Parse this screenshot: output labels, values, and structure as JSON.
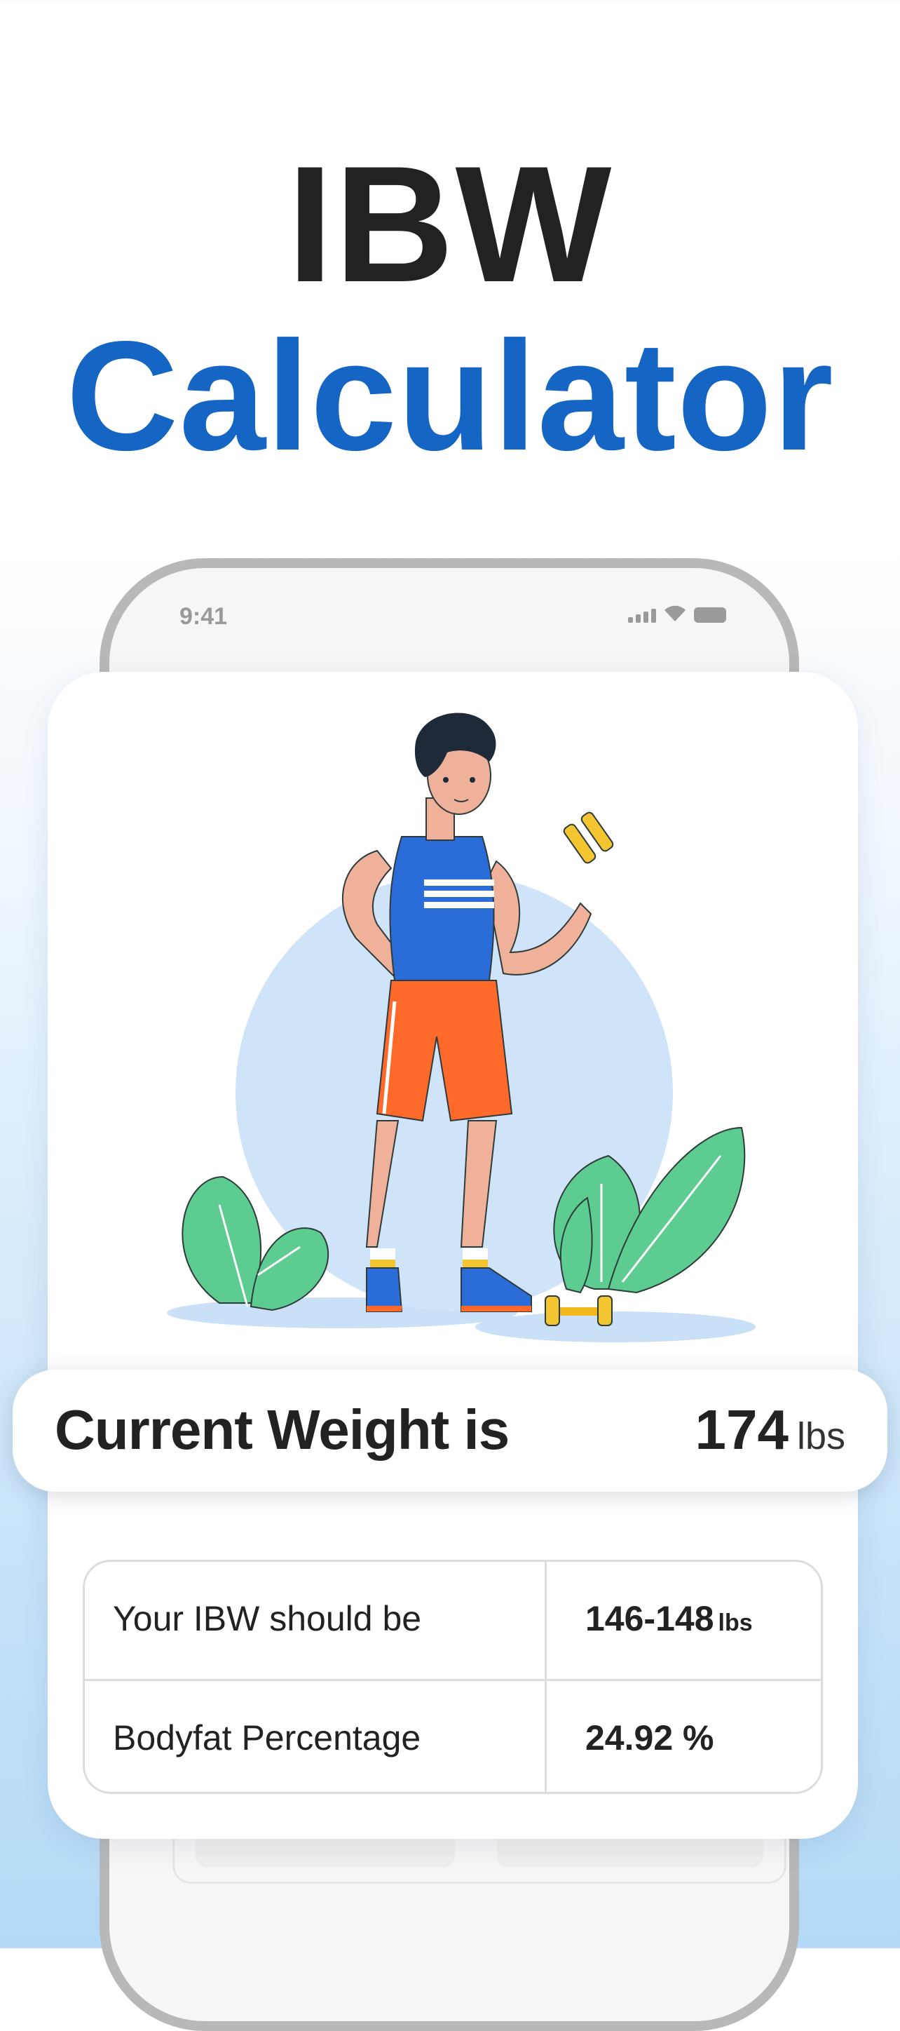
{
  "headline": {
    "line1": "IBW",
    "line2": "Calculator"
  },
  "colors": {
    "accent": "#1565c4",
    "text_dark": "#222222"
  },
  "status_bar": {
    "time": "9:41",
    "icons": [
      "signal-icon",
      "wifi-icon",
      "battery-icon"
    ]
  },
  "illustration": {
    "subject": "man-with-dumbbell"
  },
  "current_weight": {
    "label": "Current Weight is",
    "value": "174",
    "unit": "lbs"
  },
  "results": [
    {
      "label": "Your IBW should be",
      "value": "146-148",
      "unit": "lbs"
    },
    {
      "label": "Bodyfat Percentage",
      "value": "24.92 %",
      "unit": ""
    }
  ]
}
